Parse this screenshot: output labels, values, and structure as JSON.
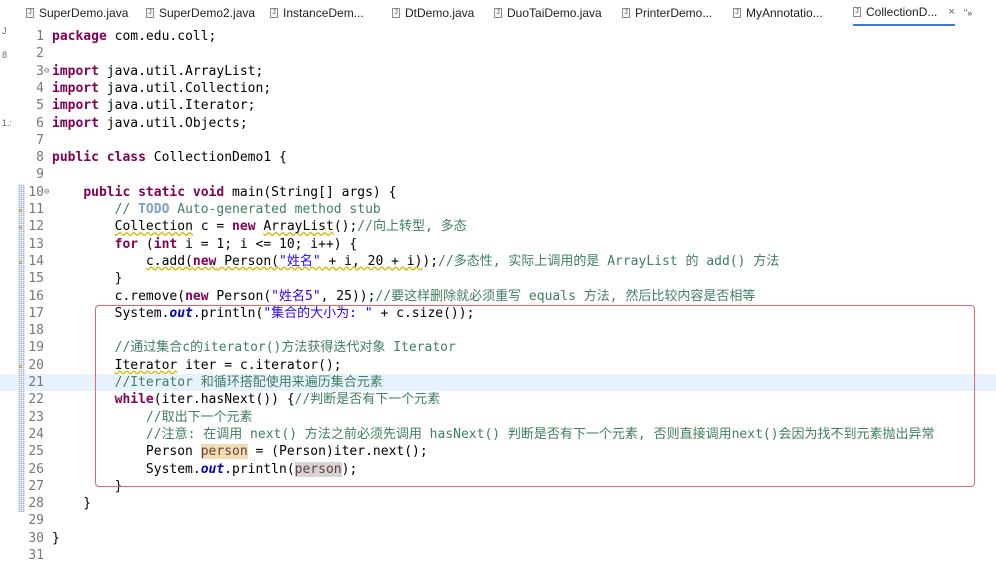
{
  "tabs": [
    {
      "label": "SuperDemo.java",
      "icon": "java-file-icon",
      "active": false
    },
    {
      "label": "SuperDemo2.java",
      "icon": "java-file-icon",
      "active": false
    },
    {
      "label": "InstanceDem...",
      "icon": "java-file-icon",
      "active": false
    },
    {
      "label": "DtDemo.java",
      "icon": "java-file-icon",
      "active": false
    },
    {
      "label": "DuoTaiDemo.java",
      "icon": "java-file-icon",
      "active": false
    },
    {
      "label": "PrinterDemo...",
      "icon": "java-file-icon",
      "active": false
    },
    {
      "label": "MyAnnotatio...",
      "icon": "java-file-icon",
      "active": false
    },
    {
      "label": "CollectionD...",
      "icon": "java-file-icon",
      "active": true,
      "close": "×"
    }
  ],
  "tab_overflow": "\"»",
  "left_gutter": [
    "J",
    "8",
    "1.:"
  ],
  "editor": {
    "highlighted_line": 21,
    "lines": [
      {
        "n": "1",
        "tokens": [
          {
            "t": "package",
            "c": "kw"
          },
          {
            "t": " com.edu.coll;"
          }
        ]
      },
      {
        "n": "2",
        "tokens": []
      },
      {
        "n": "3",
        "fold": "⊖",
        "tokens": [
          {
            "t": "import",
            "c": "kw"
          },
          {
            "t": " java.util.ArrayList;"
          }
        ]
      },
      {
        "n": "4",
        "tokens": [
          {
            "t": "import",
            "c": "kw"
          },
          {
            "t": " java.util.Collection;"
          }
        ]
      },
      {
        "n": "5",
        "tokens": [
          {
            "t": "import",
            "c": "kw"
          },
          {
            "t": " java.util.Iterator;"
          }
        ]
      },
      {
        "n": "6",
        "tokens": [
          {
            "t": "import",
            "c": "kw"
          },
          {
            "t": " java.util.Objects;"
          }
        ]
      },
      {
        "n": "7",
        "tokens": []
      },
      {
        "n": "8",
        "tokens": [
          {
            "t": "public",
            "c": "kw"
          },
          {
            "t": " "
          },
          {
            "t": "class",
            "c": "kw"
          },
          {
            "t": " CollectionDemo1 {"
          }
        ]
      },
      {
        "n": "9",
        "tokens": []
      },
      {
        "n": "10",
        "fold": "⊖",
        "tokens": [
          {
            "t": "    "
          },
          {
            "t": "public",
            "c": "kw"
          },
          {
            "t": " "
          },
          {
            "t": "static",
            "c": "kw"
          },
          {
            "t": " "
          },
          {
            "t": "void",
            "c": "kw"
          },
          {
            "t": " main(String[] args) {"
          }
        ]
      },
      {
        "n": "11",
        "tokens": [
          {
            "t": "        "
          },
          {
            "t": "// ",
            "c": "cm"
          },
          {
            "t": "TODO",
            "c": "cmt"
          },
          {
            "t": " Auto-generated method stub",
            "c": "cm"
          }
        ]
      },
      {
        "n": "12",
        "tokens": [
          {
            "t": "        "
          },
          {
            "t": "Collection",
            "c": "wv"
          },
          {
            "t": " c = "
          },
          {
            "t": "new",
            "c": "kw"
          },
          {
            "t": " "
          },
          {
            "t": "ArrayList",
            "c": "wv"
          },
          {
            "t": "();"
          },
          {
            "t": "//向上转型, 多态",
            "c": "cm"
          }
        ]
      },
      {
        "n": "13",
        "tokens": [
          {
            "t": "        "
          },
          {
            "t": "for",
            "c": "kw"
          },
          {
            "t": " ("
          },
          {
            "t": "int",
            "c": "kw"
          },
          {
            "t": " i = 1; i <= 10; i++) {"
          }
        ]
      },
      {
        "n": "14",
        "tokens": [
          {
            "t": "            "
          },
          {
            "t": "c.add(",
            "c": "wv"
          },
          {
            "t": "new",
            "c": "kw wv"
          },
          {
            "t": " Person(",
            "c": "wv"
          },
          {
            "t": "\"姓名\"",
            "c": "st wv"
          },
          {
            "t": " + i, 20 + i)",
            "c": "wv"
          },
          {
            "t": ");"
          },
          {
            "t": "//多态性, 实际上调用的是 ArrayList 的 add() 方法",
            "c": "cm"
          }
        ]
      },
      {
        "n": "15",
        "tokens": [
          {
            "t": "        }"
          }
        ]
      },
      {
        "n": "16",
        "tokens": [
          {
            "t": "        c.remove("
          },
          {
            "t": "new",
            "c": "kw"
          },
          {
            "t": " Person("
          },
          {
            "t": "\"姓名5\"",
            "c": "st"
          },
          {
            "t": ", 25));"
          },
          {
            "t": "//要这样删除就必须重写 equals 方法, 然后比较内容是否相等",
            "c": "cm"
          }
        ]
      },
      {
        "n": "17",
        "tokens": [
          {
            "t": "        System."
          },
          {
            "t": "out",
            "c": "fi"
          },
          {
            "t": ".println("
          },
          {
            "t": "\"集合的大小为: \"",
            "c": "st"
          },
          {
            "t": " + c.size());"
          }
        ]
      },
      {
        "n": "18",
        "tokens": []
      },
      {
        "n": "19",
        "tokens": [
          {
            "t": "        "
          },
          {
            "t": "//通过集合c的iterator()方法获得迭代对象 Iterator",
            "c": "cm"
          }
        ]
      },
      {
        "n": "20",
        "tokens": [
          {
            "t": "        "
          },
          {
            "t": "Iterator",
            "c": "wv"
          },
          {
            "t": " iter = c.iterator();"
          }
        ]
      },
      {
        "n": "21",
        "tokens": [
          {
            "t": "        "
          },
          {
            "t": "//Iterator 和循环搭配使用来遍历集合元素",
            "c": "cm"
          }
        ]
      },
      {
        "n": "22",
        "tokens": [
          {
            "t": "        "
          },
          {
            "t": "while",
            "c": "kw"
          },
          {
            "t": "(iter.hasNext()) {"
          },
          {
            "t": "//判断是否有下一个元素",
            "c": "cm"
          }
        ]
      },
      {
        "n": "23",
        "tokens": [
          {
            "t": "            "
          },
          {
            "t": "//取出下一个元素",
            "c": "cm"
          }
        ]
      },
      {
        "n": "24",
        "tokens": [
          {
            "t": "            "
          },
          {
            "t": "//注意: 在调用 next() 方法之前必须先调用 hasNext() 判断是否有下一个元素, 否则直接调用next()会因为找不到元素抛出异常",
            "c": "cm"
          }
        ]
      },
      {
        "n": "25",
        "tokens": [
          {
            "t": "            Person "
          },
          {
            "t": "person",
            "c": "vl occ"
          },
          {
            "t": " = (Person)iter.next();"
          }
        ]
      },
      {
        "n": "26",
        "tokens": [
          {
            "t": "            System."
          },
          {
            "t": "out",
            "c": "fi"
          },
          {
            "t": ".println("
          },
          {
            "t": "person",
            "c": "vl occ2"
          },
          {
            "t": ");"
          }
        ]
      },
      {
        "n": "27",
        "tokens": [
          {
            "t": "        }"
          }
        ]
      },
      {
        "n": "28",
        "tokens": [
          {
            "t": "    }"
          }
        ]
      },
      {
        "n": "29",
        "tokens": []
      },
      {
        "n": "30",
        "tokens": [
          {
            "t": "}"
          }
        ]
      },
      {
        "n": "31",
        "tokens": []
      }
    ]
  }
}
